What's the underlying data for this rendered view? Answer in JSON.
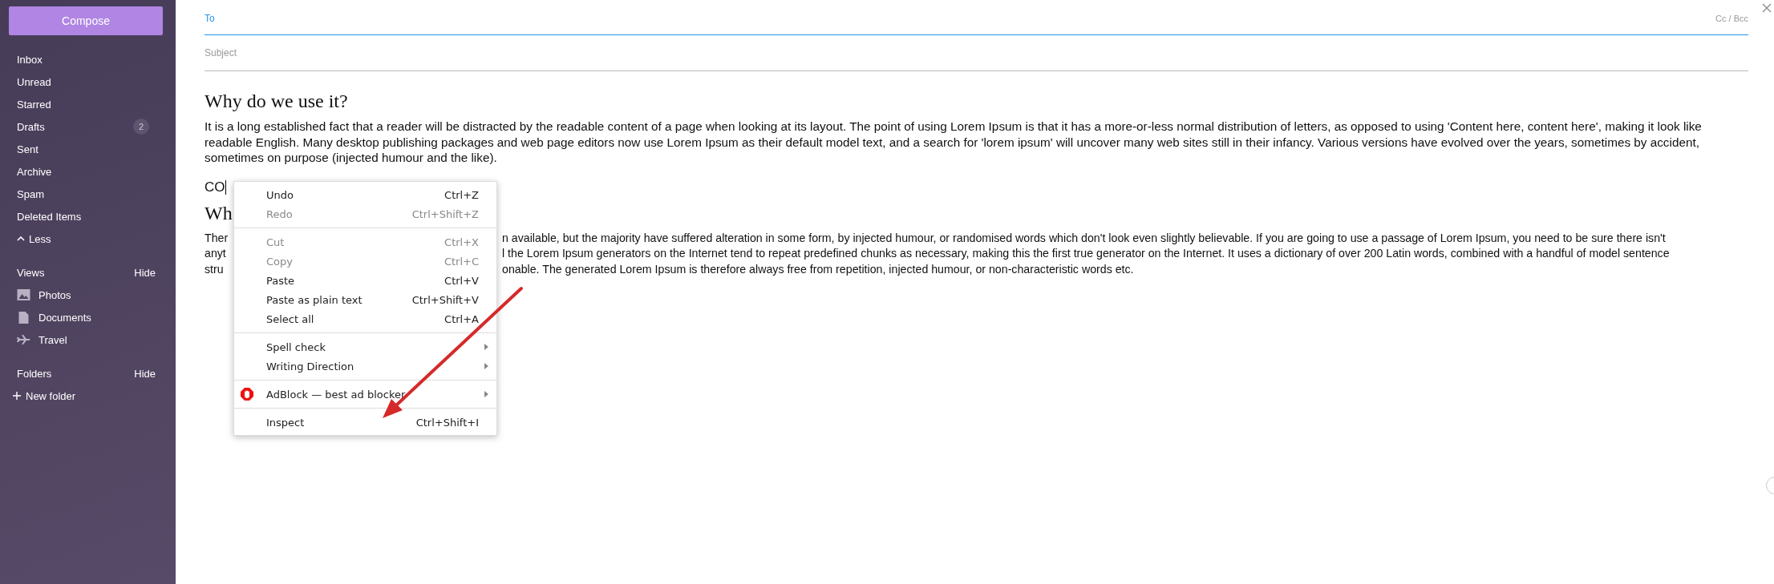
{
  "sidebar": {
    "compose": "Compose",
    "nav": [
      {
        "label": "Inbox"
      },
      {
        "label": "Unread"
      },
      {
        "label": "Starred"
      },
      {
        "label": "Drafts",
        "badge": "2"
      },
      {
        "label": "Sent"
      },
      {
        "label": "Archive"
      },
      {
        "label": "Spam"
      },
      {
        "label": "Deleted Items"
      }
    ],
    "toggle": {
      "label": "Less",
      "expanded": true
    },
    "views": {
      "title": "Views",
      "action": "Hide",
      "items": [
        {
          "label": "Photos",
          "kind": "photos"
        },
        {
          "label": "Documents",
          "kind": "documents"
        },
        {
          "label": "Travel",
          "kind": "travel"
        }
      ]
    },
    "folders": {
      "title": "Folders",
      "action": "Hide"
    },
    "new_folder": "New folder"
  },
  "compose": {
    "to_label": "To",
    "cc_bcc": "Cc / Bcc",
    "subject_placeholder": "Subject"
  },
  "body": [
    {
      "kind": "heading",
      "text": "Why do we use it?"
    },
    {
      "kind": "paragraph",
      "text": "It is a long established fact that a reader will be distracted by the readable content of a page when looking at its layout. The point of using Lorem Ipsum is that it has a more-or-less normal distribution of letters, as opposed to using 'Content here, content here', making it look like readable English. Many desktop publishing packages and web page editors now use Lorem Ipsum as their default model text, and a search for 'lorem ipsum' will uncover many web sites still in their infancy. Various versions have evolved over the years, sometimes by accident, sometimes on purpose (injected humour and the like)."
    },
    {
      "kind": "line",
      "text": "CO"
    },
    {
      "kind": "heading",
      "text": "Wh"
    },
    {
      "kind": "split",
      "lines": [
        {
          "left": "Ther",
          "right": "n available, but the majority have suffered alteration in some form, by injected humour, or randomised words which don't look even slightly believable. If you are going to use a passage of Lorem Ipsum, you need to be sure there isn't"
        },
        {
          "left": "anyt",
          "right": "l the Lorem Ipsum generators on the Internet tend to repeat predefined chunks as necessary, making this the first true generator on the Internet. It uses a dictionary of over 200 Latin words, combined with a handful of model sentence"
        },
        {
          "left": "stru",
          "right": "onable. The generated Lorem Ipsum is therefore always free from repetition, injected humour, or non-characteristic words etc."
        }
      ]
    }
  ],
  "context_menu": {
    "groups": [
      [
        {
          "label": "Undo",
          "shortcut": "Ctrl+Z",
          "disabled": false
        },
        {
          "label": "Redo",
          "shortcut": "Ctrl+Shift+Z",
          "disabled": true
        }
      ],
      [
        {
          "label": "Cut",
          "shortcut": "Ctrl+X",
          "disabled": true
        },
        {
          "label": "Copy",
          "shortcut": "Ctrl+C",
          "disabled": true
        },
        {
          "label": "Paste",
          "shortcut": "Ctrl+V",
          "disabled": false
        },
        {
          "label": "Paste as plain text",
          "shortcut": "Ctrl+Shift+V",
          "disabled": false
        },
        {
          "label": "Select all",
          "shortcut": "Ctrl+A",
          "disabled": false
        }
      ],
      [
        {
          "label": "Spell check",
          "submenu": true,
          "disabled": false
        },
        {
          "label": "Writing Direction",
          "submenu": true,
          "disabled": false
        }
      ],
      [
        {
          "label": "AdBlock — best ad blocker",
          "submenu": true,
          "kind": "extension",
          "disabled": false
        }
      ],
      [
        {
          "label": "Inspect",
          "shortcut": "Ctrl+Shift+I",
          "disabled": false
        }
      ]
    ]
  }
}
